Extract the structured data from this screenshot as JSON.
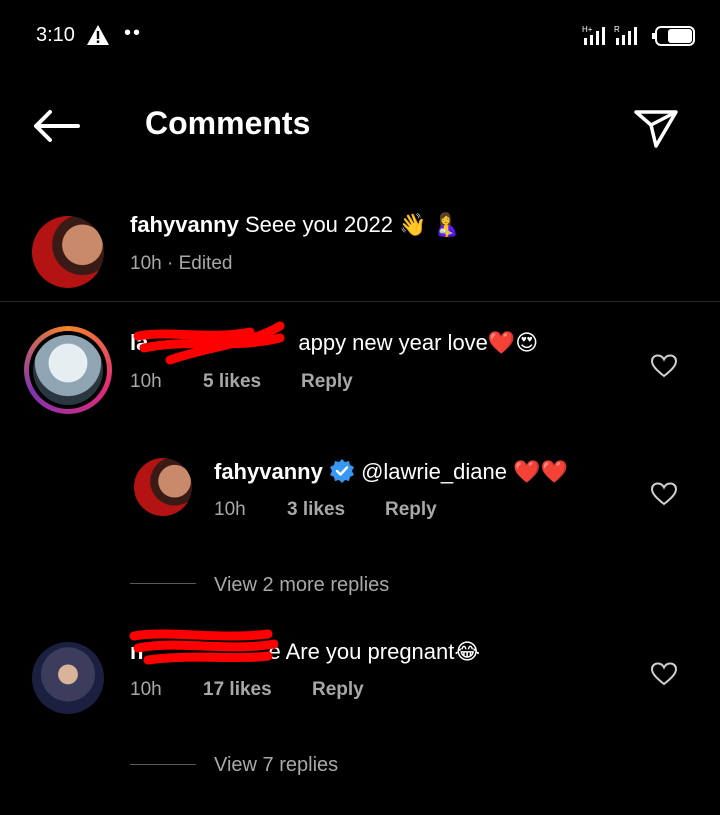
{
  "status_bar": {
    "time": "3:10",
    "dots": "••"
  },
  "header": {
    "title": "Comments"
  },
  "caption": {
    "username": "fahyvanny",
    "text": "Seee you 2022 👋 🤱",
    "time": "10h",
    "edited": "Edited"
  },
  "comments": [
    {
      "username_visible_prefix": "la",
      "text": "appy new year love❤️😍",
      "time": "10h",
      "likes": "5 likes",
      "reply": "Reply",
      "reply_thread": {
        "username": "fahyvanny",
        "text": "@lawrie_diane ❤️❤️",
        "time": "10h",
        "likes": "3 likes",
        "reply": "Reply"
      },
      "view_more": "View 2 more replies"
    },
    {
      "username_visible_prefix": "n",
      "text": "e Are you pregnant😂",
      "time": "10h",
      "likes": "17 likes",
      "reply": "Reply",
      "view_more": "View 7 replies"
    }
  ],
  "colors": {
    "background": "#000000",
    "text": "#ffffff",
    "secondary": "#a8a8a8",
    "verified": "#3897f0",
    "redaction": "#ff0000"
  }
}
